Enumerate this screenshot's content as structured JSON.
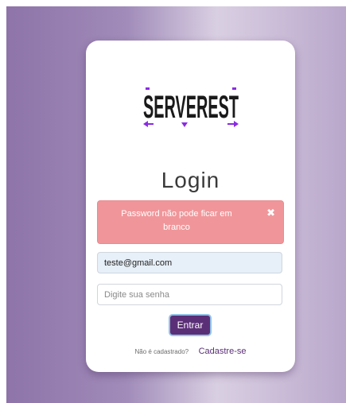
{
  "brand": {
    "logo_text": "SERVEREST",
    "logo_color": "#1a1a1a",
    "accent_color": "#8a2be2"
  },
  "login": {
    "title": "Login"
  },
  "alert": {
    "message": "Password não pode ficar em branco",
    "close_icon": "close-icon",
    "background_color": "#f0969a"
  },
  "form": {
    "email": {
      "value": "teste@gmail.com",
      "placeholder": ""
    },
    "password": {
      "value": "",
      "placeholder": "Digite sua senha"
    },
    "submit_label": "Entrar",
    "button_color": "#5b2f77"
  },
  "signup": {
    "question": "Não é cadastrado?",
    "link_label": "Cadastre-se"
  }
}
